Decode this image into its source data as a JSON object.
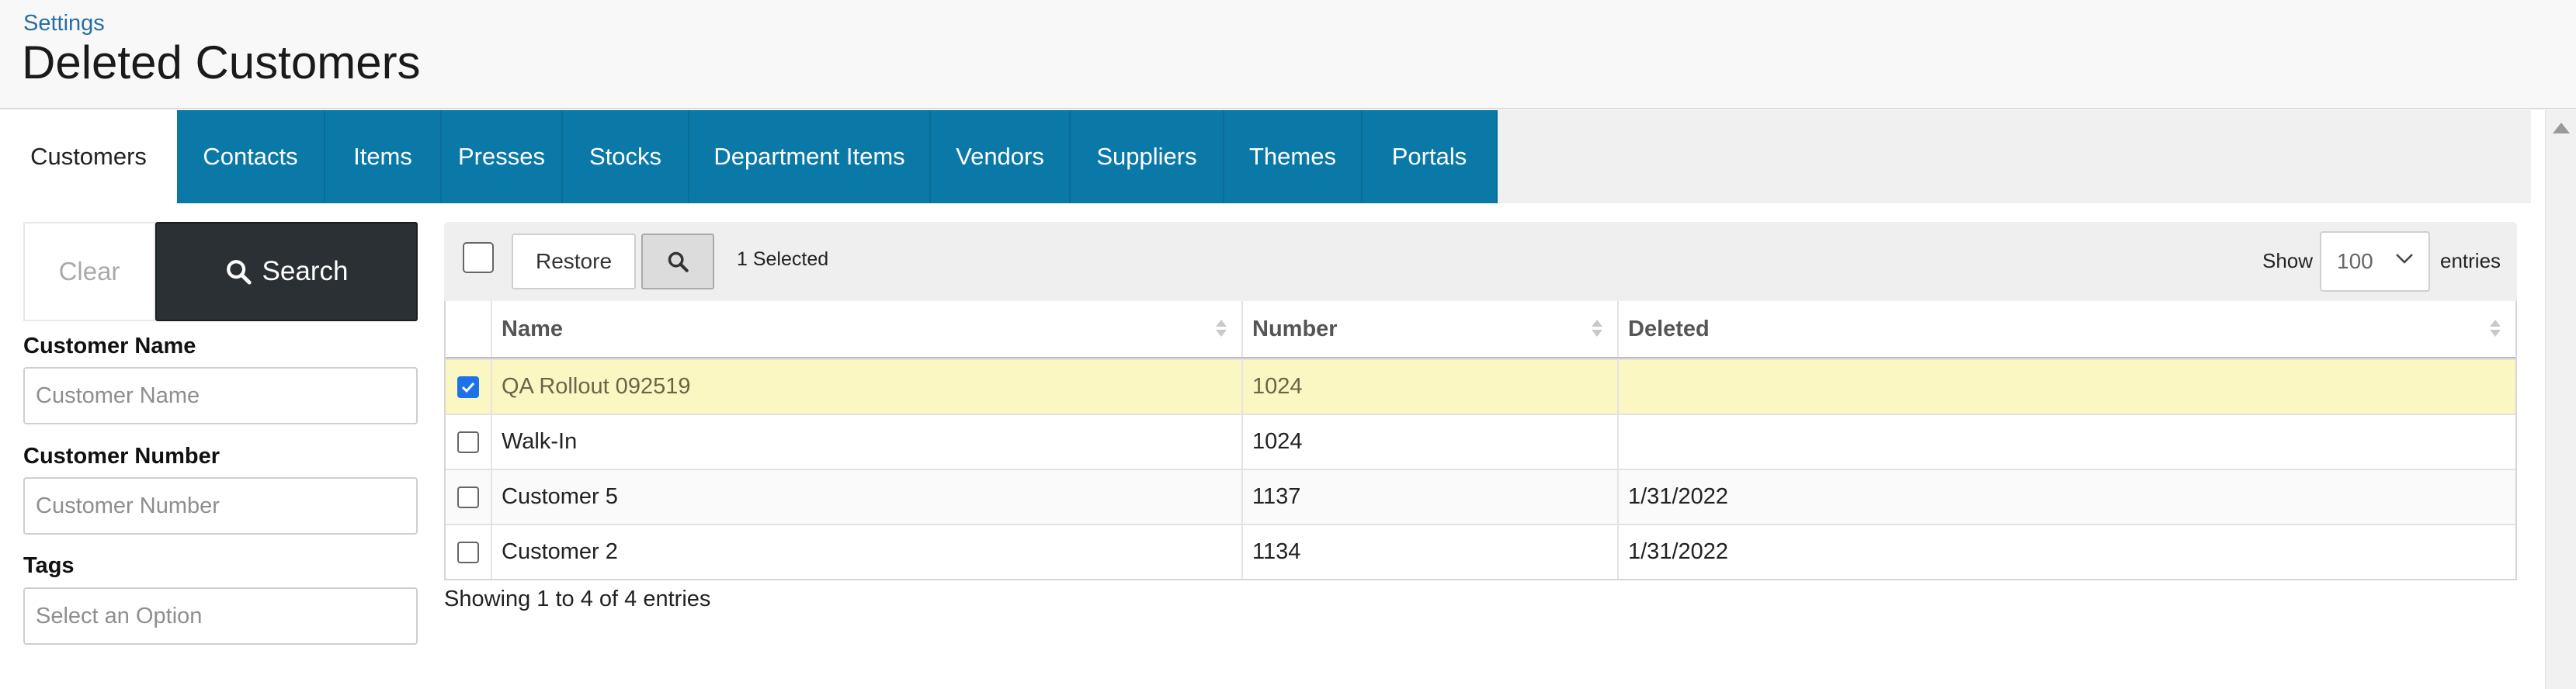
{
  "header": {
    "breadcrumb": "Settings",
    "title": "Deleted Customers"
  },
  "tabs": [
    {
      "label": "Customers",
      "active": true
    },
    {
      "label": "Contacts",
      "active": false
    },
    {
      "label": "Items",
      "active": false
    },
    {
      "label": "Presses",
      "active": false
    },
    {
      "label": "Stocks",
      "active": false
    },
    {
      "label": "Department Items",
      "active": false
    },
    {
      "label": "Vendors",
      "active": false
    },
    {
      "label": "Suppliers",
      "active": false
    },
    {
      "label": "Themes",
      "active": false
    },
    {
      "label": "Portals",
      "active": false
    }
  ],
  "filters": {
    "clear_label": "Clear",
    "search_label": "Search",
    "customer_name": {
      "label": "Customer Name",
      "placeholder": "Customer Name",
      "value": ""
    },
    "customer_number": {
      "label": "Customer Number",
      "placeholder": "Customer Number",
      "value": ""
    },
    "tags": {
      "label": "Tags",
      "placeholder": "Select an Option"
    }
  },
  "toolbar": {
    "restore_label": "Restore",
    "selected_text": "1 Selected",
    "show_label": "Show",
    "page_size": "100",
    "entries_label": "entries"
  },
  "table": {
    "columns": [
      "Name",
      "Number",
      "Deleted"
    ],
    "rows": [
      {
        "name": "QA Rollout 092519",
        "number": "1024",
        "deleted": "",
        "checked": true
      },
      {
        "name": "Walk-In",
        "number": "1024",
        "deleted": "",
        "checked": false
      },
      {
        "name": "Customer 5",
        "number": "1137",
        "deleted": "1/31/2022",
        "checked": false
      },
      {
        "name": "Customer 2",
        "number": "1134",
        "deleted": "1/31/2022",
        "checked": false
      }
    ],
    "info": "Showing 1 to 4 of 4 entries"
  },
  "colors": {
    "tab_bg": "#0b79a8",
    "search_button_bg": "#2b3034",
    "selected_row_bg": "#fbf7c3",
    "link": "#2a6da1"
  },
  "icons": {
    "search": "magnifying-glass",
    "select": "chevron-down",
    "sort": "sort-arrows",
    "scroll": "arrow-up"
  }
}
